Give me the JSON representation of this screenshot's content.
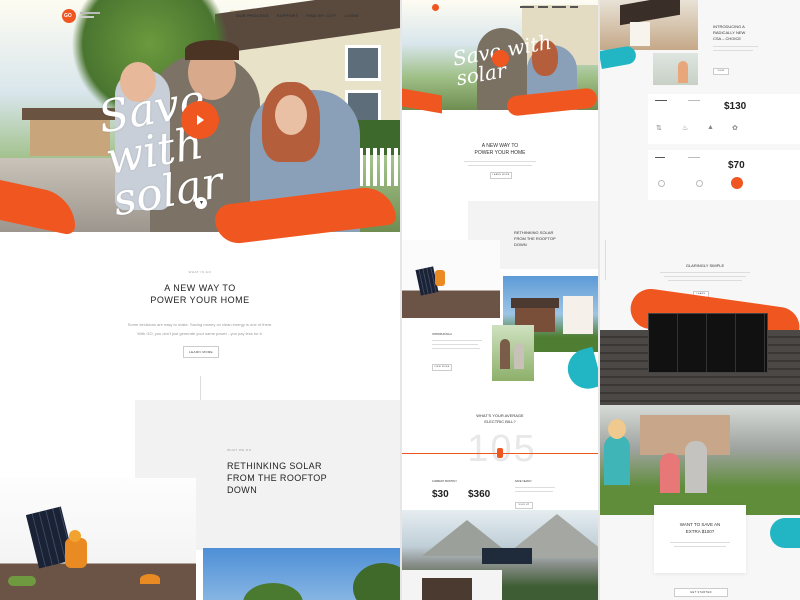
{
  "nav": {
    "logo": "GO",
    "items": [
      "OUR PROCESS",
      "SUPPORT",
      "FIND MY CITY",
      "LOGIN"
    ]
  },
  "hero": {
    "script_text": "Save with solar",
    "play_label": "Play video"
  },
  "intro": {
    "eyebrow": "WHAT IS GO",
    "title_line1": "A NEW WAY TO",
    "title_line2": "POWER YOUR HOME",
    "body_line1": "Some decisions are easy to make. Saving money on clean energy is one of them.",
    "body_line2": "With GO, you don't just generate your same power - you pay less for it.",
    "cta": "LEARN MORE"
  },
  "rethink": {
    "eyebrow": "WHAT WE DO",
    "title_line1": "RETHINKING SOLAR",
    "title_line2": "FROM THE ROOFTOP",
    "title_line3": "DOWN"
  },
  "middle": {
    "intro_title_line1": "A NEW WAY TO",
    "intro_title_line2": "POWER YOUR HOME",
    "intro_cta": "LEARN MORE",
    "rethink_line1": "RETHINKING SOLAR",
    "rethink_line2": "FROM THE ROOFTOP",
    "rethink_line3": "DOWN",
    "card_title": "INTRODUCING A",
    "card_cta": "VIEW MORE",
    "bill_title_line1": "WHAT'S YOUR AVERAGE",
    "bill_title_line2": "ELECTRIC BILL?",
    "bill_number": "105",
    "plan_a_label": "CURRENT MONTHLY",
    "plan_a_price": "$30",
    "plan_b_price": "$360",
    "plan_b_label": "SAVE YEARLY",
    "plan_cta": "SIGN UP"
  },
  "right": {
    "intro_line1": "INTRODUCING A",
    "intro_line2": "RADICALLY NEW",
    "intro_line3": "CSA – CHOICE",
    "intro_cta": "VIEW",
    "price_1": "$130",
    "price_2": "$70",
    "simple_title": "GLARINGLY SIMPLE",
    "simple_cta": "LEARN",
    "save_line1": "WANT TO SAVE AN",
    "save_line2": "EXTRA $100?",
    "footer_cta": "GET STARTED"
  },
  "colors": {
    "accent": "#f0561f",
    "teal": "#22b5c4",
    "text": "#333333"
  }
}
